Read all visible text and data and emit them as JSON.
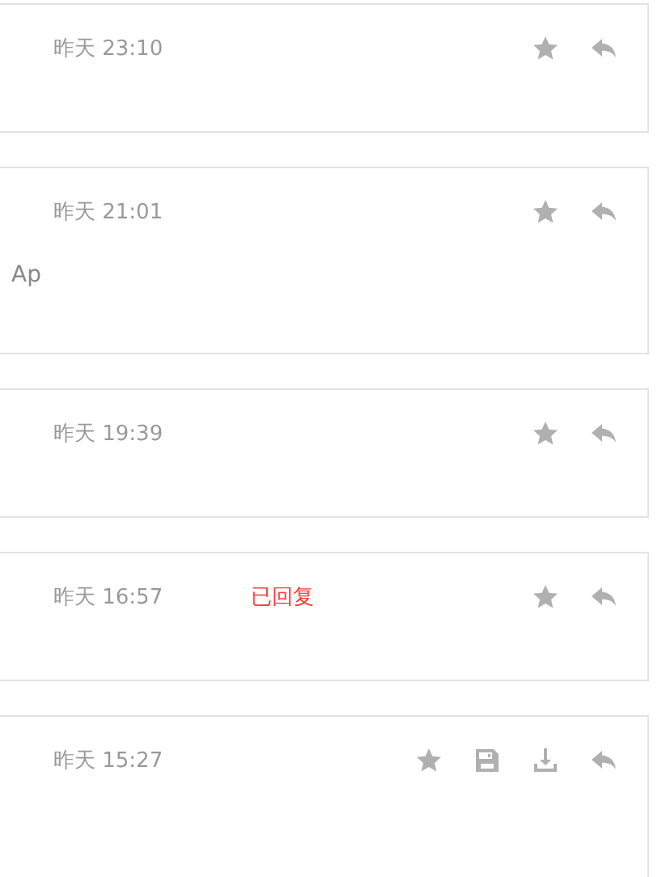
{
  "messages": [
    {
      "time": "昨天 23:10",
      "actions": [
        {
          "kind": "star"
        },
        {
          "kind": "reply"
        }
      ]
    },
    {
      "time": "昨天 21:01",
      "snippet": "Ap",
      "actions": [
        {
          "kind": "star"
        },
        {
          "kind": "reply"
        }
      ]
    },
    {
      "time": "昨天 19:39",
      "actions": [
        {
          "kind": "star"
        },
        {
          "kind": "reply"
        }
      ]
    },
    {
      "time": "昨天 16:57",
      "status": "已回复",
      "actions": [
        {
          "kind": "star"
        },
        {
          "kind": "reply"
        }
      ]
    },
    {
      "time": "昨天 15:27",
      "actions": [
        {
          "kind": "star"
        },
        {
          "kind": "save"
        },
        {
          "kind": "download"
        },
        {
          "kind": "reply"
        }
      ]
    }
  ]
}
